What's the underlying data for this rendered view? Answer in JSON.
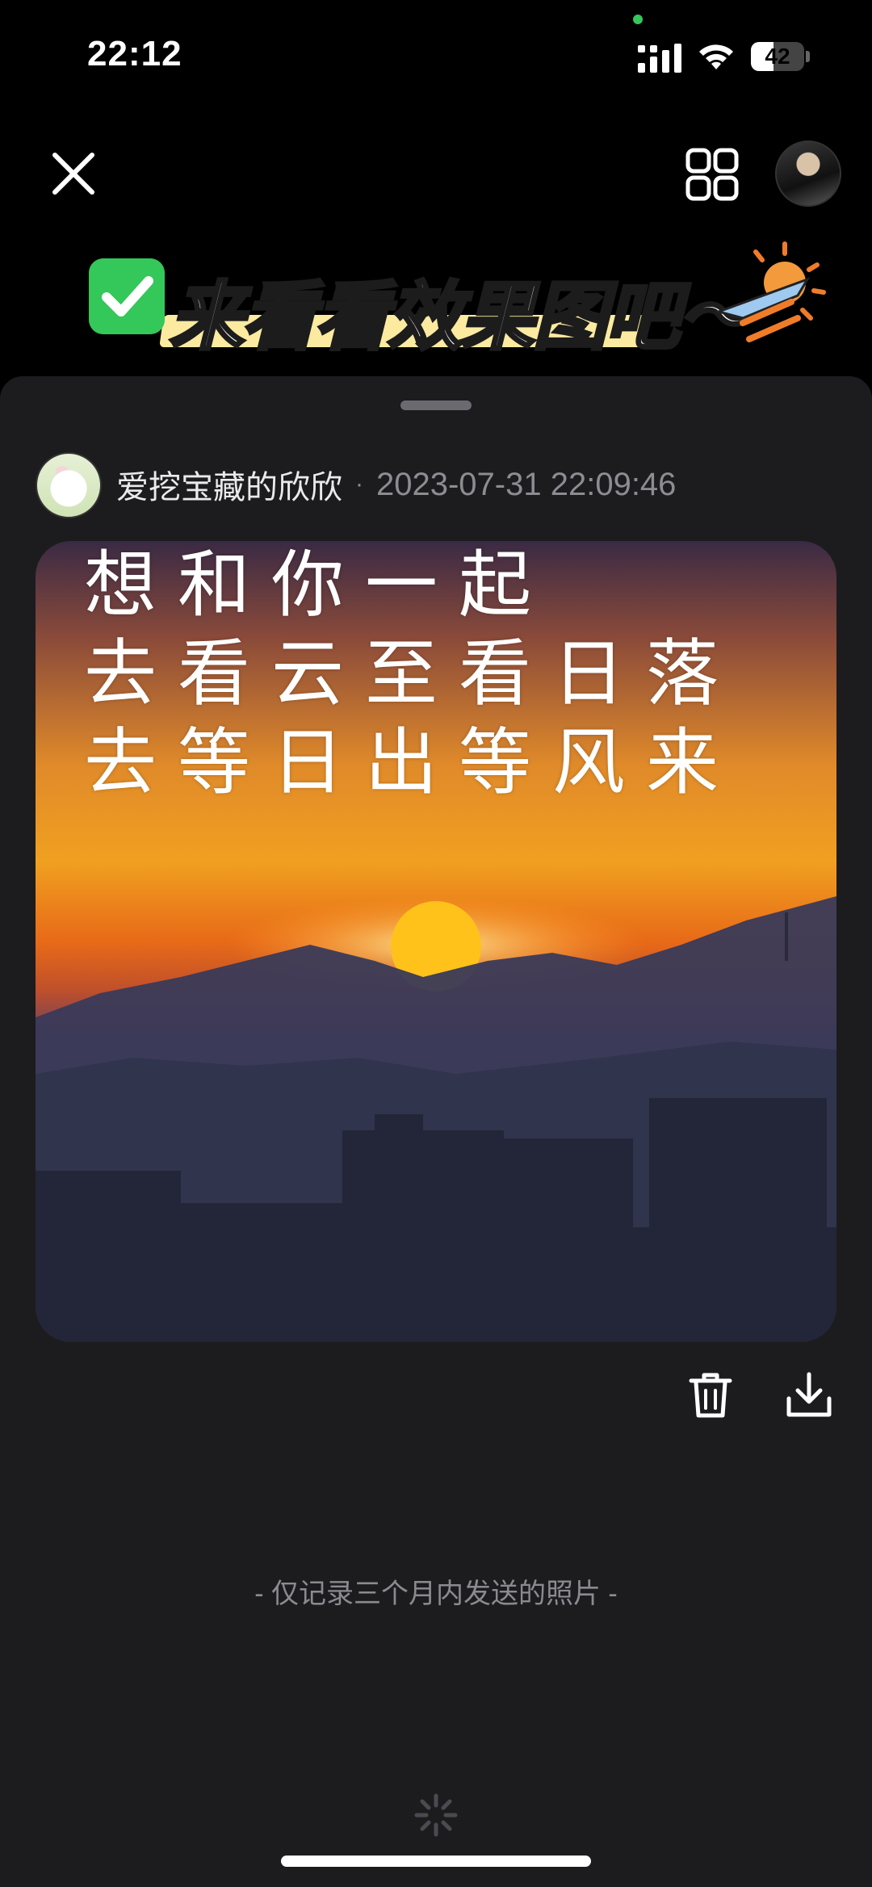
{
  "status_bar": {
    "time": "22:12",
    "battery": "42",
    "battery_level": 0.42
  },
  "top_bar": {
    "close_icon": "close-icon",
    "grid_icon": "grid-icon",
    "avatar": "user-avatar"
  },
  "banner": {
    "text": "来看看效果图吧～",
    "check_icon": "check-mark-icon",
    "sticker": "sun-airplane-sticker"
  },
  "post": {
    "author": "爱挖宝藏的欣欣",
    "separator": "·",
    "timestamp": "2023-07-31 22:09:46",
    "caption_lines": [
      "想和你一起",
      "去看云至看日落",
      "去等日出等风来"
    ]
  },
  "actions": {
    "delete_icon": "trash-icon",
    "download_icon": "download-icon"
  },
  "footer": {
    "note": "- 仅记录三个月内发送的照片 -"
  },
  "colors": {
    "sheet_bg": "#1c1c1f",
    "accent_green": "#34c759",
    "muted_text": "#8c8c92"
  }
}
